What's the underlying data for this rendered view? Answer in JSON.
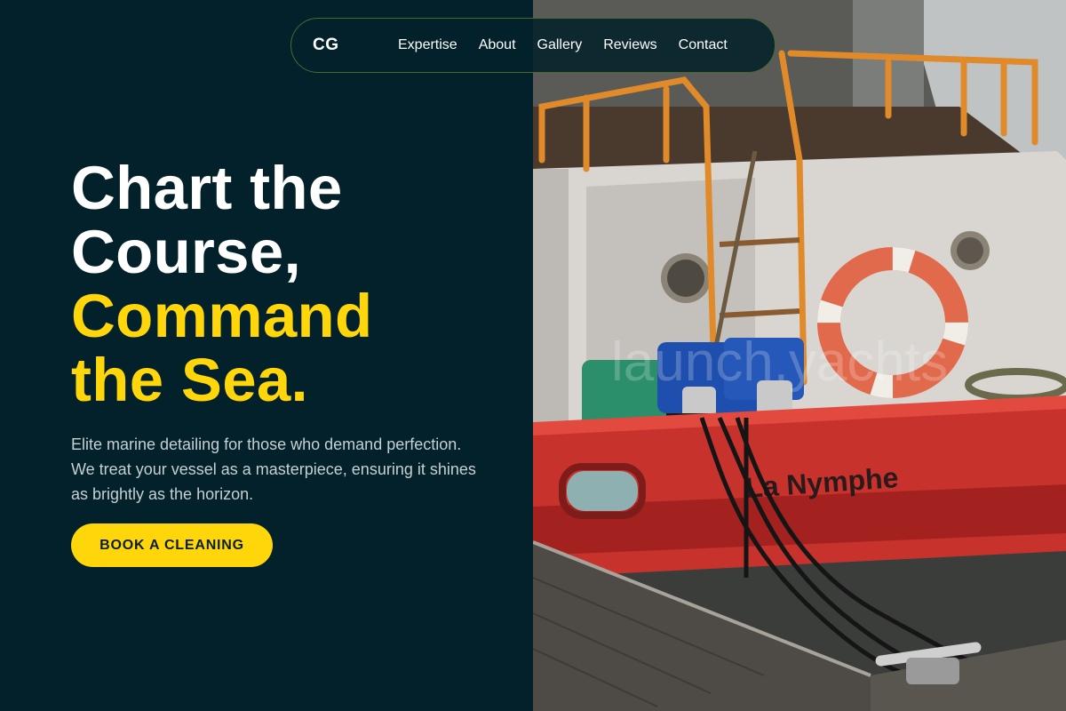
{
  "nav": {
    "logo": "CG",
    "links": [
      "Expertise",
      "About",
      "Gallery",
      "Reviews",
      "Contact"
    ]
  },
  "hero": {
    "title_line1": "Chart the",
    "title_line2": "Course,",
    "title_line3": "Command",
    "title_line4": "the Sea.",
    "description": "Elite marine detailing for those who demand perfection. We treat your vessel as a masterpiece, ensuring it shines as brightly as the horizon.",
    "cta_label": "BOOK A CLEANING"
  },
  "image": {
    "boat_name": "La Nymphe",
    "watermark": "launch.yachts"
  },
  "colors": {
    "background": "#02212a",
    "accent": "#ffd60a",
    "text": "#ffffff"
  }
}
